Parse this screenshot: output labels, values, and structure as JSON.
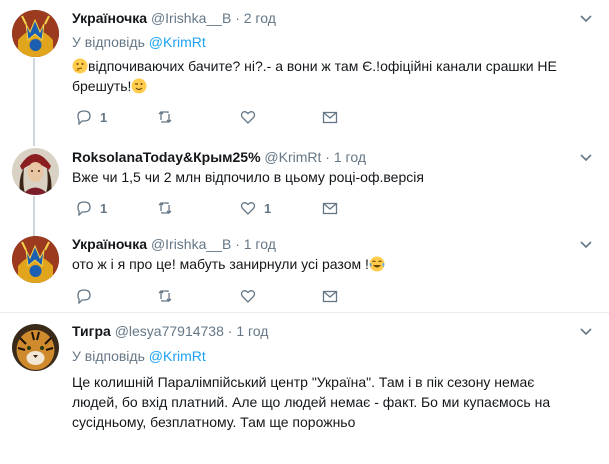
{
  "tweets": [
    {
      "name": "Україночка",
      "handle": "@Irishka__B",
      "dot": "·",
      "time": "2 год",
      "reply_prefix": "У відповідь",
      "reply_to": "@KrimRt",
      "text1": "відпочиваючих бачите? ні?.- а вони ж там Є.!офіційні канали срашки НЕ",
      "text2": "брешуть!",
      "emoji_start": "thinking-face",
      "emoji_end": "winking-face",
      "reply_count": "1",
      "retweet_count": "",
      "like_count": "",
      "avatar": "trident-crest"
    },
    {
      "name": "RoksolanaToday&Крым25%",
      "handle": "@KrimRt",
      "dot": "·",
      "time": "1 год",
      "text1": "Вже чи 1,5 чи 2 млн відпочило в цьому році-оф.версія",
      "reply_count": "1",
      "retweet_count": "",
      "like_count": "1",
      "avatar": "portrait-headdress"
    },
    {
      "name": "Україночка",
      "handle": "@Irishka__B",
      "dot": "·",
      "time": "1 год",
      "text1": "ото ж і я про це! мабуть занирнули усі разом !",
      "emoji_end": "tears-of-joy",
      "reply_count": "",
      "retweet_count": "",
      "like_count": "",
      "avatar": "trident-crest"
    },
    {
      "name": "Тигра",
      "handle": "@lesya77914738",
      "dot": "·",
      "time": "1 год",
      "reply_prefix": "У відповідь",
      "reply_to": "@KrimRt",
      "text1": "Це колишній Паралімпійський центр \"Україна\". Там і в пік сезону немає",
      "text2": "людей, бо вхід платний. Але що людей немає - факт. Бо ми купаємось на",
      "text3": "сусідньому, безплатному. Там ще порожньо",
      "avatar": "tiger-face"
    }
  ],
  "colors": {
    "link": "#1da1f2",
    "muted": "#657786",
    "text": "#14171a",
    "divider": "#e6ecf0"
  }
}
